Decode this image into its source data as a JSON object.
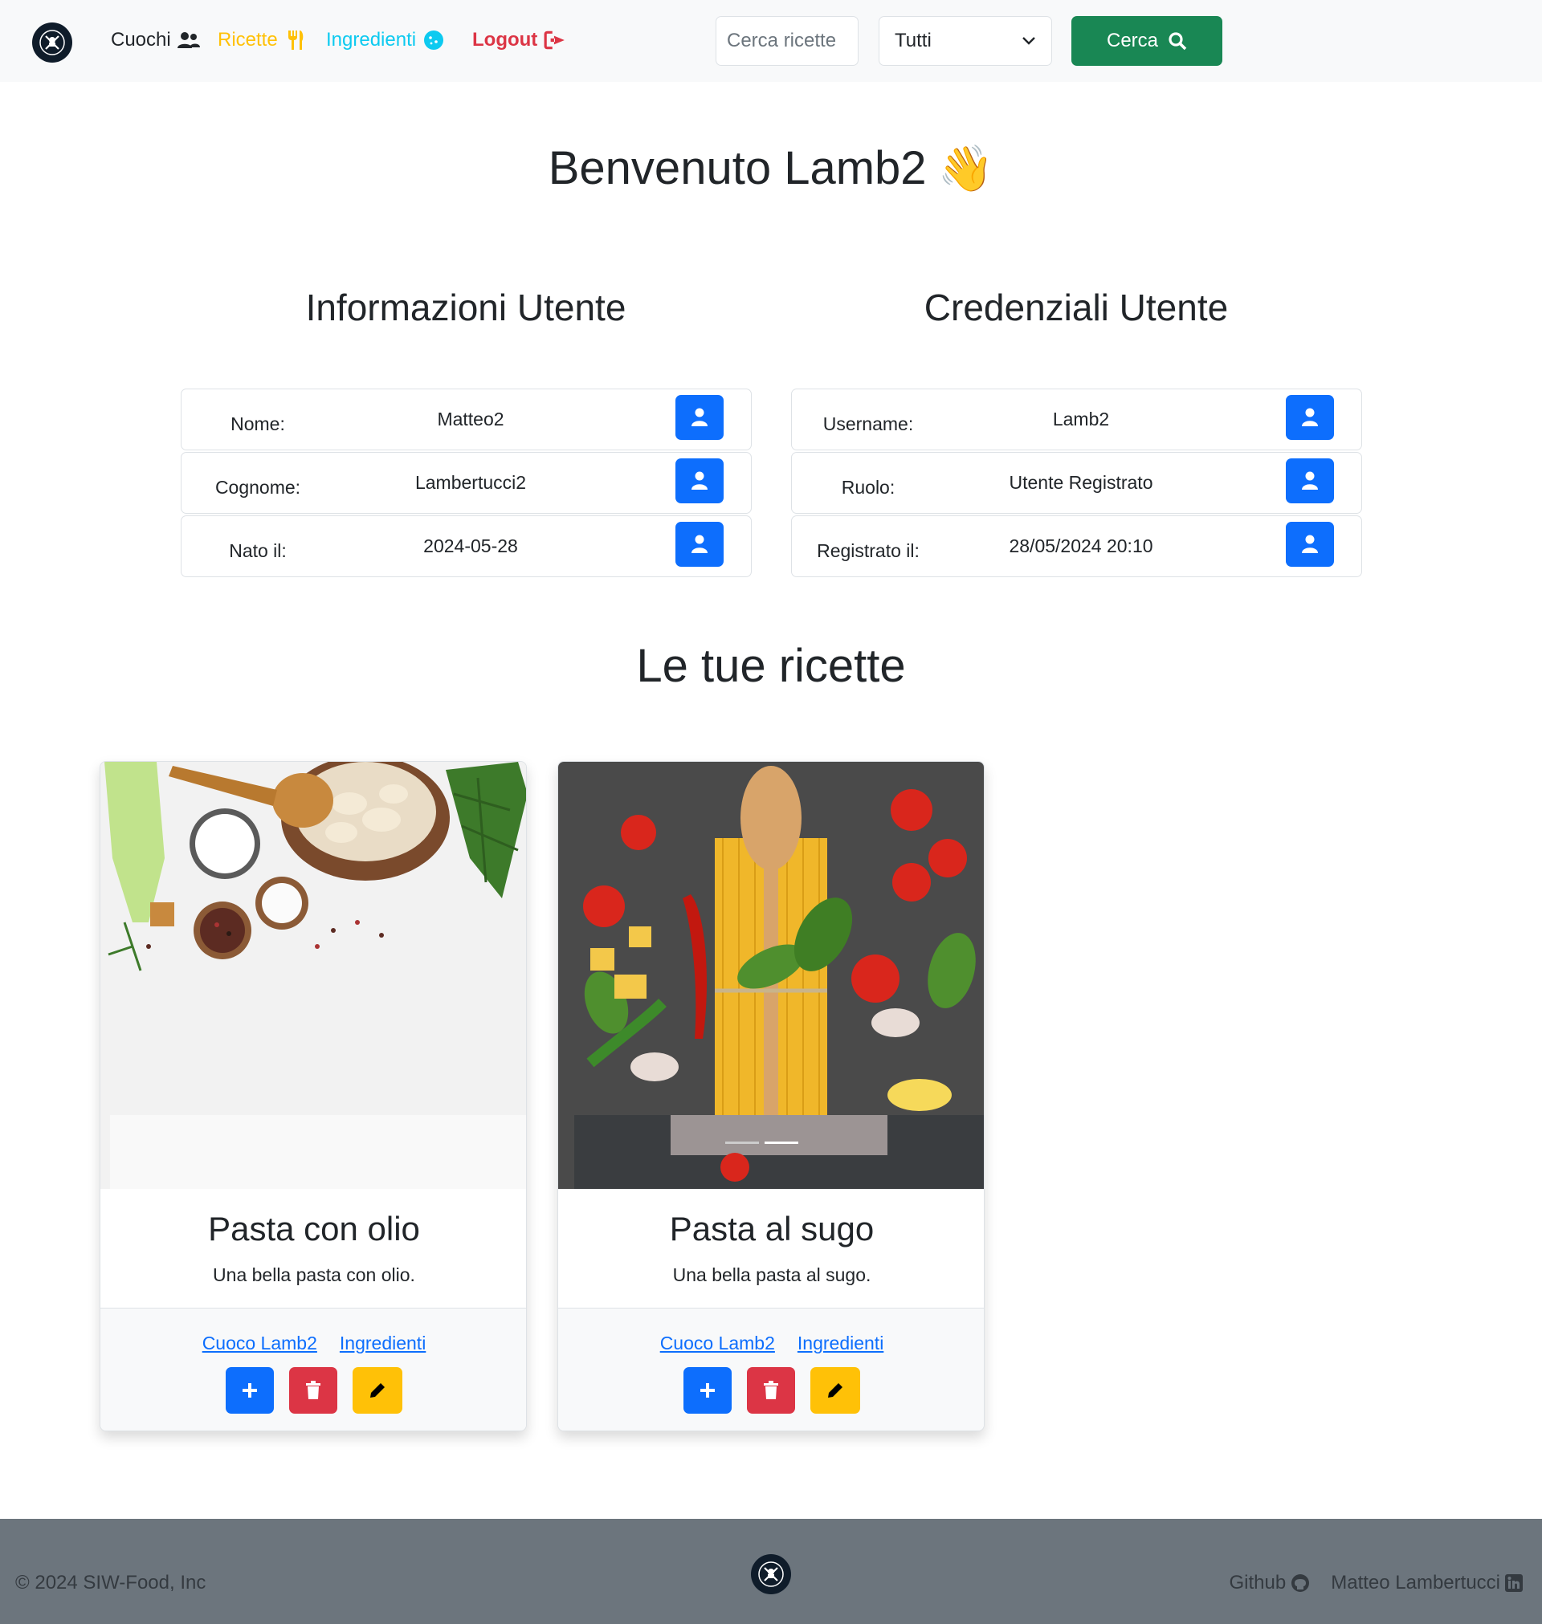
{
  "nav": {
    "cuochi": "Cuochi",
    "ricette": "Ricette",
    "ingredienti": "Ingredienti",
    "logout": "Logout",
    "search_placeholder": "Cerca ricette",
    "select_value": "Tutti",
    "search_button": "Cerca"
  },
  "welcome": {
    "text": "Benvenuto Lamb2",
    "emoji": "👋"
  },
  "info": {
    "title": "Informazioni Utente",
    "rows": [
      {
        "label": "Nome:",
        "value": "Matteo2"
      },
      {
        "label": "Cognome:",
        "value": "Lambertucci2"
      },
      {
        "label": "Nato il:",
        "value": "2024-05-28"
      }
    ]
  },
  "credentials": {
    "title": "Credenziali Utente",
    "rows": [
      {
        "label": "Username:",
        "value": "Lamb2"
      },
      {
        "label": "Ruolo:",
        "value": "Utente Registrato"
      },
      {
        "label": "Registrato il:",
        "value": "28/05/2024 20:10"
      }
    ]
  },
  "recipes": {
    "title": "Le tue ricette",
    "cards": [
      {
        "title": "Pasta con olio",
        "description": "Una bella pasta con olio.",
        "cook_link": "Cuoco Lamb2",
        "ingredients_link": "Ingredienti"
      },
      {
        "title": "Pasta al sugo",
        "description": "Una bella pasta al sugo.",
        "cook_link": "Cuoco Lamb2",
        "ingredients_link": "Ingredienti"
      }
    ]
  },
  "footer": {
    "copyright": "© 2024 SIW-Food, Inc",
    "github": "Github",
    "linkedin": "Matteo Lambertucci"
  },
  "colors": {
    "primary": "#0d6efd",
    "danger": "#dc3545",
    "warning": "#ffc107",
    "info": "#0dcaf0",
    "success": "#198754",
    "footer_bg": "#6c757d"
  }
}
